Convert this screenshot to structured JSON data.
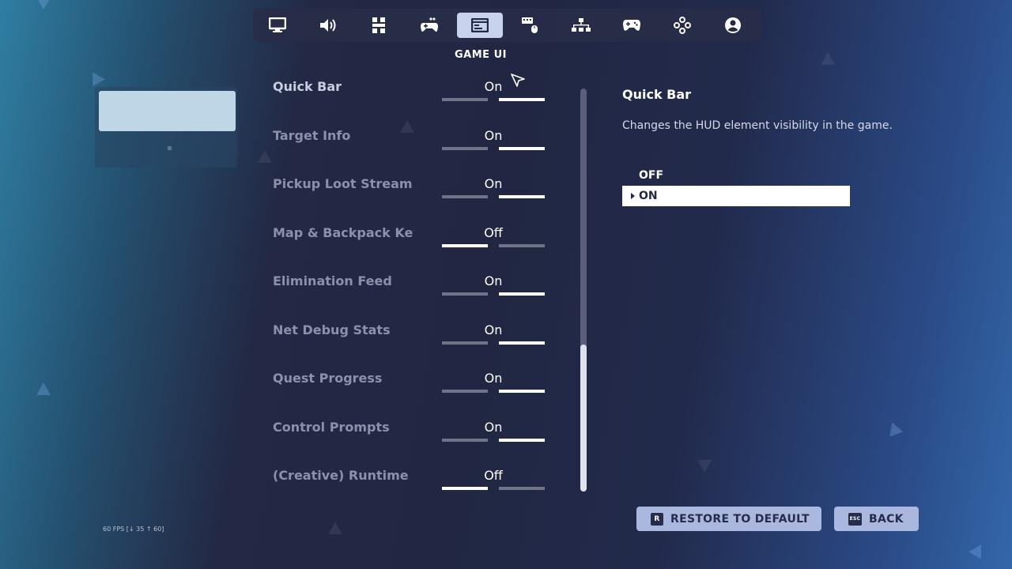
{
  "nav": {
    "tabs": [
      {
        "icon": "monitor-icon",
        "active": false
      },
      {
        "icon": "speaker-icon",
        "active": false
      },
      {
        "icon": "grid-icon",
        "active": false
      },
      {
        "icon": "controller-settings-icon",
        "active": false
      },
      {
        "icon": "game-ui-icon",
        "active": true
      },
      {
        "icon": "keyboard-mouse-icon",
        "active": false
      },
      {
        "icon": "network-icon",
        "active": false
      },
      {
        "icon": "gamepad-icon",
        "active": false
      },
      {
        "icon": "dpad-icon",
        "active": false
      },
      {
        "icon": "account-icon",
        "active": false
      }
    ]
  },
  "section": {
    "title": "GAME UI"
  },
  "settings": [
    {
      "label": "Quick Bar",
      "value": "On",
      "state": "on"
    },
    {
      "label": "Target Info",
      "value": "On",
      "state": "on"
    },
    {
      "label": "Pickup Loot Stream",
      "value": "On",
      "state": "on"
    },
    {
      "label": "Map & Backpack Key Shortcuts",
      "value": "Off",
      "state": "off"
    },
    {
      "label": "Elimination Feed",
      "value": "On",
      "state": "on"
    },
    {
      "label": "Net Debug Stats",
      "value": "On",
      "state": "on"
    },
    {
      "label": "Quest Progress",
      "value": "On",
      "state": "on"
    },
    {
      "label": "Control Prompts",
      "value": "On",
      "state": "on"
    },
    {
      "label": "(Creative) Runtime Info",
      "value": "Off",
      "state": "off"
    }
  ],
  "detail": {
    "title": "Quick Bar",
    "description": "Changes the HUD element visibility in the game.",
    "options": [
      "OFF",
      "ON"
    ],
    "selected": "ON"
  },
  "buttons": {
    "restore_key": "R",
    "restore_label": "RESTORE TO DEFAULT",
    "back_key": "ESC",
    "back_label": "BACK"
  },
  "fps": "60 FPS [↓ 35 ↑ 60]",
  "colors": {
    "accent": "#c9d2ec",
    "button": "#aab7de",
    "text": "#ffffff",
    "muted": "#8b91a8"
  }
}
